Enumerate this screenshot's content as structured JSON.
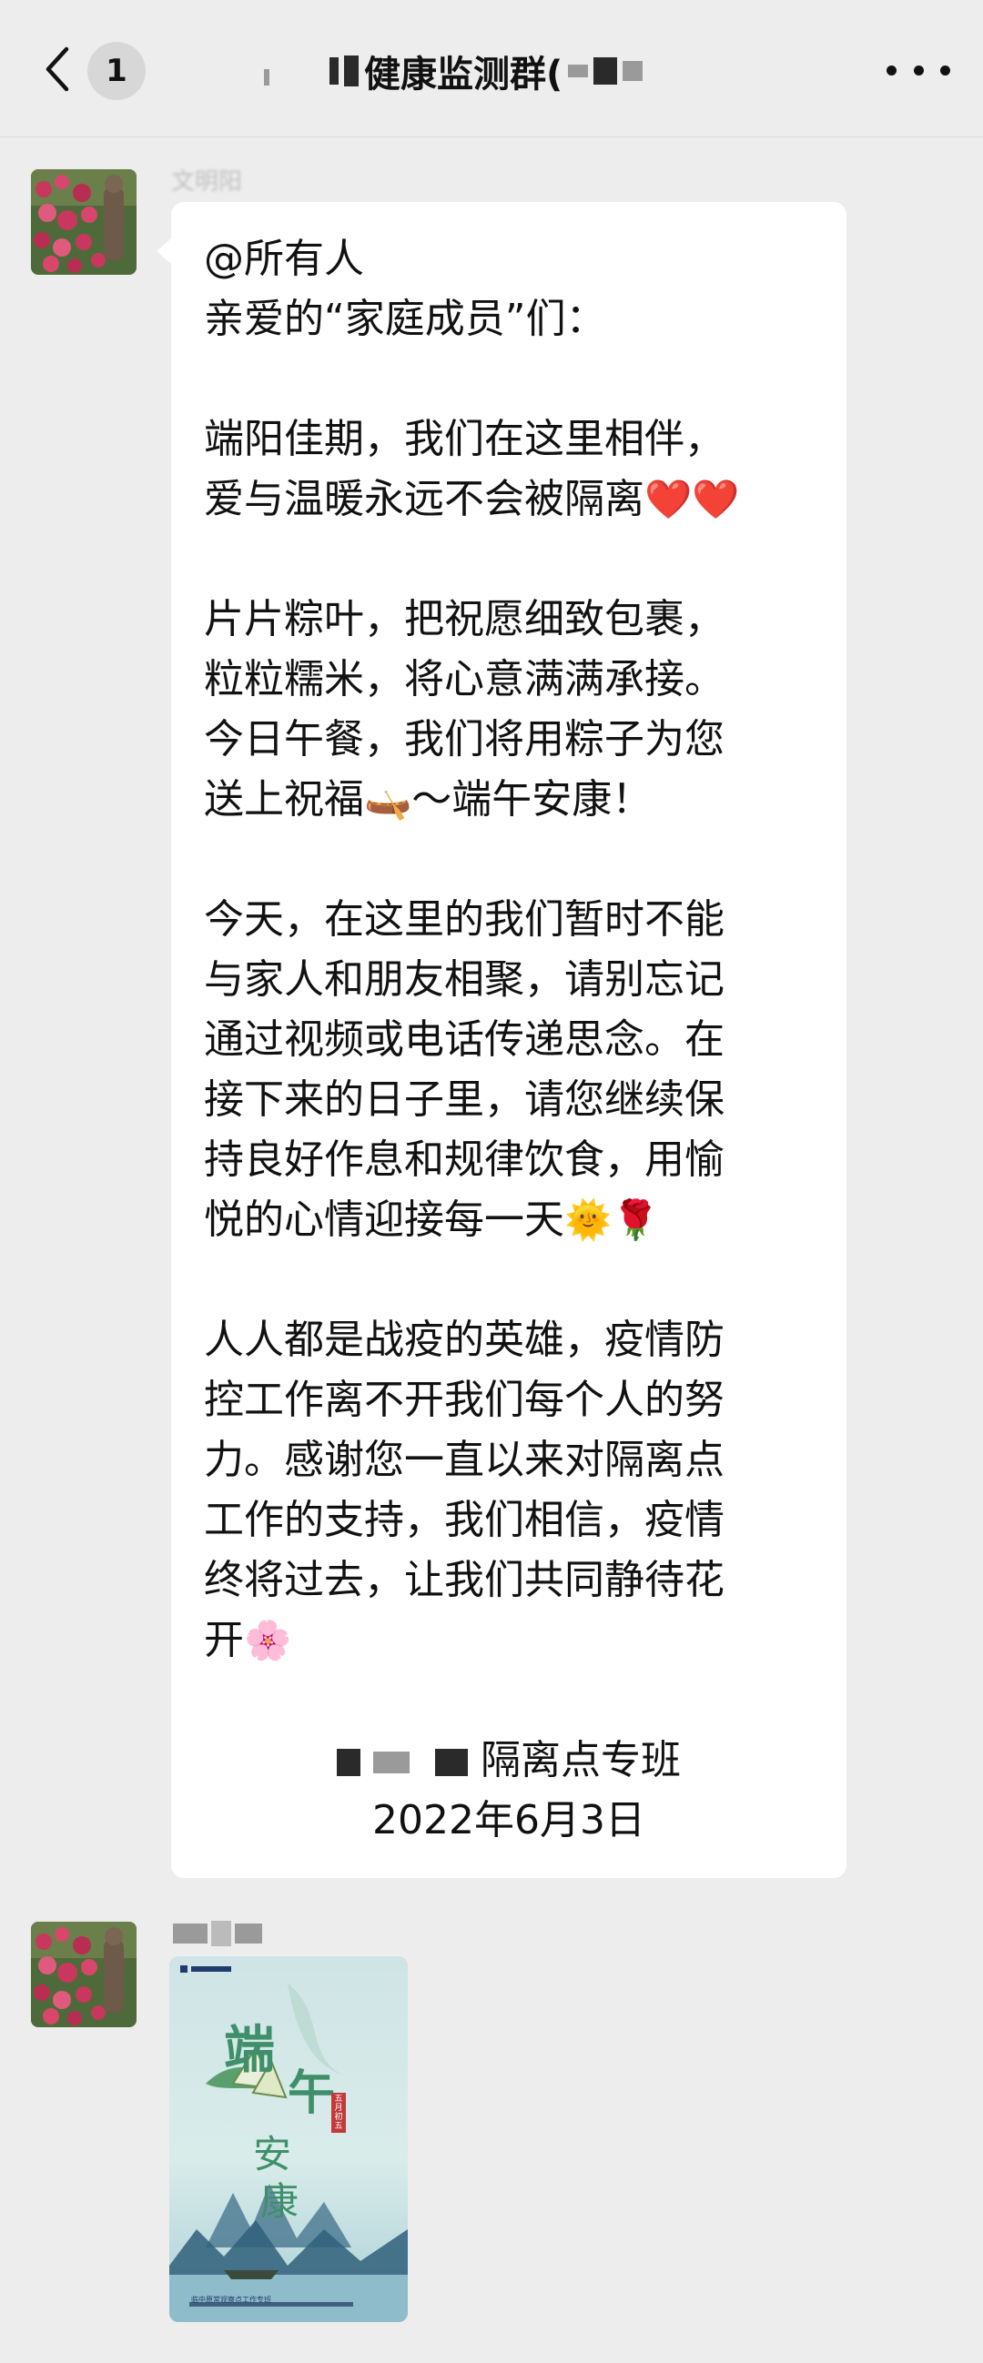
{
  "header": {
    "back_count": "1",
    "title": "健康监测群(",
    "more_icon": "more-dots-icon"
  },
  "messages": [
    {
      "sender": "文明阳",
      "lines": [
        "@所有人",
        "亲爱的“家庭成员”们：",
        "",
        "端阳佳期，我们在这里相伴，",
        "爱与温暖永远不会被隔离",
        "",
        "片片粽叶，把祝愿细致包裹，",
        "粒粒糯米，将心意满满承接。",
        "今日午餐，我们将用粽子为您",
        "送上祝福",
        "",
        "今天，在这里的我们暂时不能",
        "与家人和朋友相聚，请别忘记",
        "通过视频或电话传递思念。在",
        "接下来的日子里，请您继续保",
        "持良好作息和规律饮食，用愉",
        "悦的心情迎接每一天",
        "",
        "人人都是战疫的英雄，疫情防",
        "控工作离不开我们每个人的努",
        "力。感谢您一直以来对隔离点",
        "工作的支持，我们相信，疫情",
        "终将过去，让我们共同静待花",
        "开"
      ],
      "emoji_hearts": "❤️❤️",
      "emoji_boat": "🛶",
      "after_boat": "～端午安康！",
      "emoji_sun_rose": "🌞🌹",
      "emoji_flower": "🌸",
      "signature_suffix": "隔离点专班",
      "signature_date": "2022年6月3日"
    },
    {
      "sender": "",
      "poster": {
        "big_chars": [
          "端",
          "午",
          "安",
          "康"
        ],
        "badge": "五月初五",
        "footer": "临中原常观察点工作专班"
      }
    }
  ],
  "colors": {
    "background": "#ededed",
    "bubble": "#ffffff",
    "poster_sky": "#cfe4e6",
    "poster_green": "#3f8f6a"
  }
}
